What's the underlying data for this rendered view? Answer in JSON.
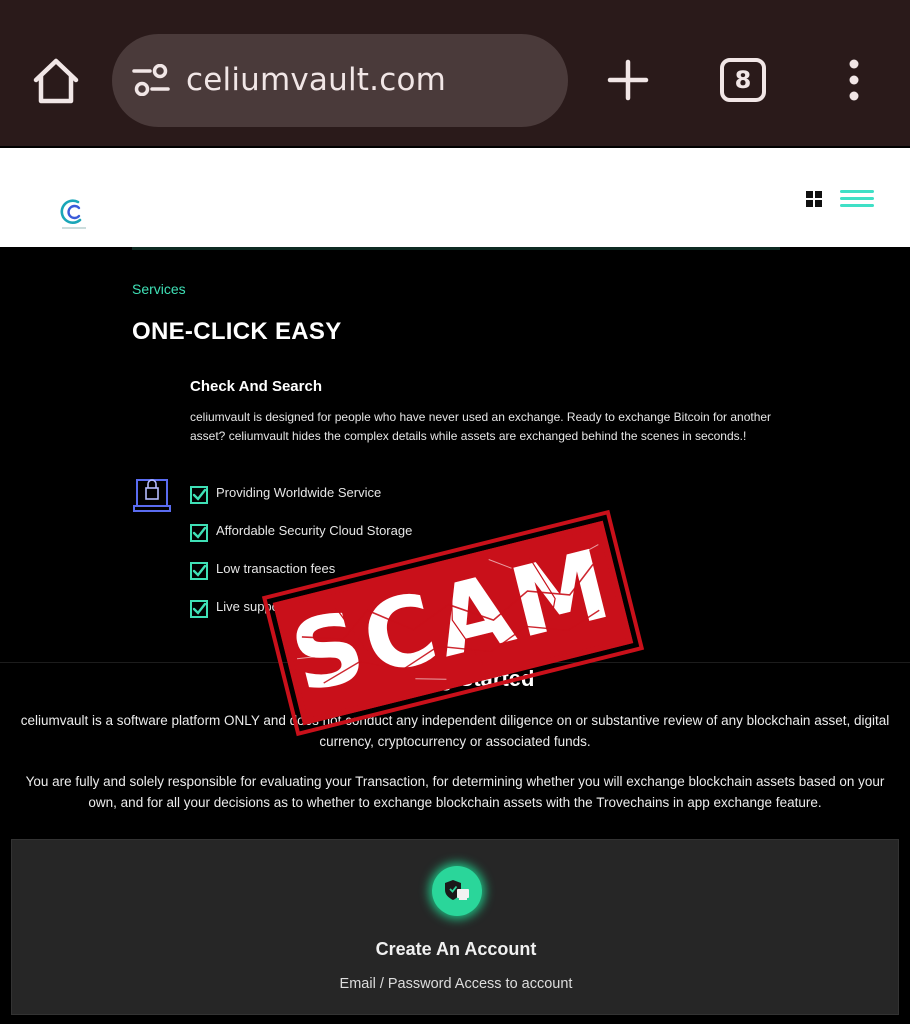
{
  "browser": {
    "url": "celiumvault.com",
    "tab_count": "8",
    "icons": [
      "home-icon",
      "site-settings-icon",
      "new-tab-icon",
      "tab-switcher-icon",
      "more-menu-icon"
    ]
  },
  "header": {
    "logo_icon": "celiumvault-logo",
    "icons": [
      "grid-icon",
      "hamburger-menu-icon"
    ]
  },
  "services": {
    "label": "Services",
    "title": "ONE-CLICK EASY",
    "feature": {
      "title": "Check And Search",
      "description": "celiumvault is designed for people who have never used an exchange. Ready to exchange Bitcoin for another asset? celiumvault hides the complex details while assets are exchanged behind the scenes in seconds.!"
    },
    "checklist": [
      {
        "label": "Providing Worldwide Service"
      },
      {
        "label": "Affordable Security Cloud Storage"
      },
      {
        "label": "Low transaction fees"
      },
      {
        "label": "Live support"
      }
    ]
  },
  "getting_started": {
    "title": "Getting Started",
    "paragraph_1": "celiumvault is a software platform ONLY and does not conduct any independent diligence on or substantive review of any blockchain asset, digital currency, cryptocurrency or associated funds.",
    "paragraph_2": "You are fully and solely responsible for evaluating your Transaction, for determining whether you will exchange blockchain assets based on your own, and for all your decisions as to whether to exchange blockchain assets with the Trovechains in app exchange feature."
  },
  "account_card": {
    "title": "Create An Account",
    "subtitle": "Email / Password Access to account"
  },
  "stamp": {
    "text": "SCAM"
  },
  "colors": {
    "accent": "#3fe0b6",
    "stamp_red": "#c9101a",
    "chrome_bg": "#2a1a1a"
  }
}
